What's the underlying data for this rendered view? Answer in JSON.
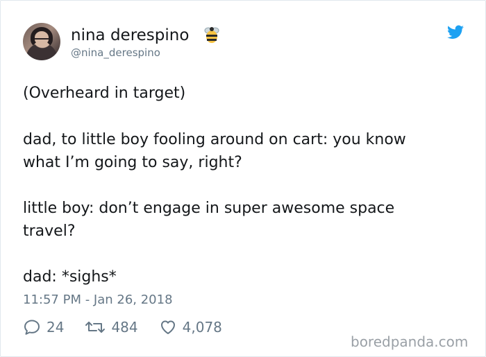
{
  "tweet": {
    "author": {
      "name": "nina derespino",
      "handle": "@nina_derespino",
      "emoji": "bee-emoji"
    },
    "lines": [
      "(Overheard in target)",
      "dad, to little boy fooling around on cart: you know",
      "what I’m going to say, right?",
      "little boy: don’t engage in super awesome space",
      "travel?",
      "dad: *sighs*"
    ],
    "timestamp": "11:57 PM - Jan 26, 2018",
    "stats": {
      "replies": "24",
      "retweets": "484",
      "likes": "4,078"
    }
  },
  "icons": {
    "reply": "reply-icon",
    "retweet": "retweet-icon",
    "like": "heart-icon",
    "brand": "twitter-bird-icon"
  },
  "colors": {
    "text": "#14171a",
    "secondary": "#657786",
    "twitter_blue": "#1da1f2",
    "border": "#e1e8ed"
  },
  "watermark": "boredpanda.com"
}
